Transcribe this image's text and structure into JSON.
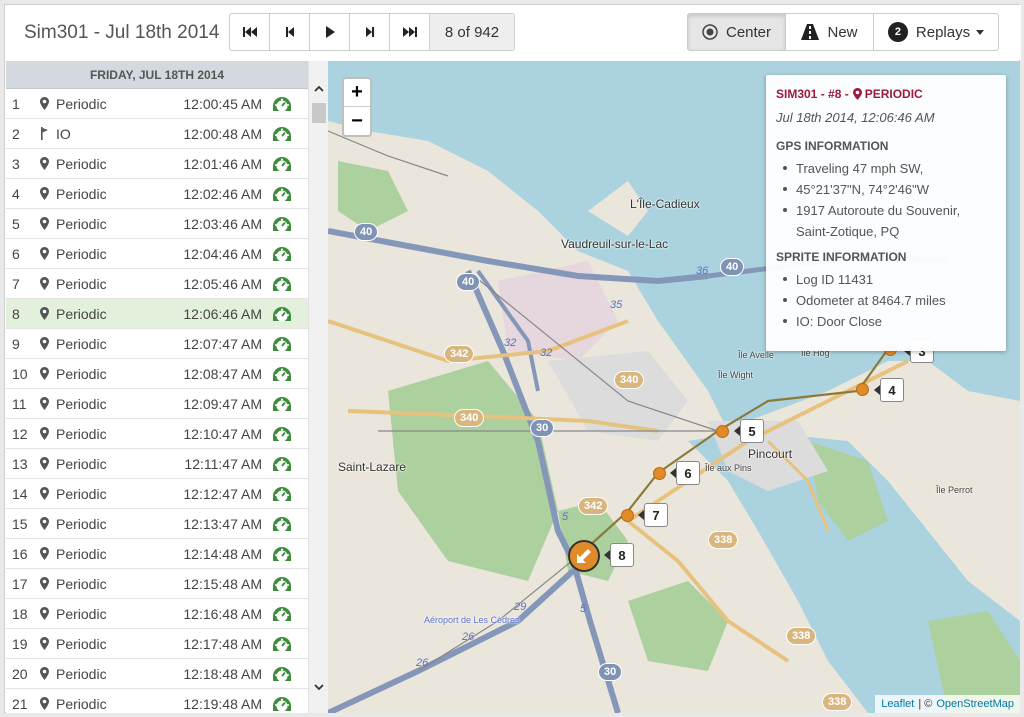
{
  "header": {
    "title": "Sim301 - Jul 18th 2014",
    "position_counter": "8 of 942",
    "center_label": "Center",
    "new_label": "New",
    "replays_label": "Replays",
    "replays_count": "2"
  },
  "list": {
    "day_header": "FRIDAY, JUL 18TH 2014",
    "selected_index": 8,
    "rows": [
      {
        "num": "1",
        "type": "Periodic",
        "icon": "pin-icon",
        "time": "12:00:45 AM"
      },
      {
        "num": "2",
        "type": "IO",
        "icon": "flag-icon",
        "time": "12:00:48 AM"
      },
      {
        "num": "3",
        "type": "Periodic",
        "icon": "pin-icon",
        "time": "12:01:46 AM"
      },
      {
        "num": "4",
        "type": "Periodic",
        "icon": "pin-icon",
        "time": "12:02:46 AM"
      },
      {
        "num": "5",
        "type": "Periodic",
        "icon": "pin-icon",
        "time": "12:03:46 AM"
      },
      {
        "num": "6",
        "type": "Periodic",
        "icon": "pin-icon",
        "time": "12:04:46 AM"
      },
      {
        "num": "7",
        "type": "Periodic",
        "icon": "pin-icon",
        "time": "12:05:46 AM"
      },
      {
        "num": "8",
        "type": "Periodic",
        "icon": "pin-icon",
        "time": "12:06:46 AM"
      },
      {
        "num": "9",
        "type": "Periodic",
        "icon": "pin-icon",
        "time": "12:07:47 AM"
      },
      {
        "num": "10",
        "type": "Periodic",
        "icon": "pin-icon",
        "time": "12:08:47 AM"
      },
      {
        "num": "11",
        "type": "Periodic",
        "icon": "pin-icon",
        "time": "12:09:47 AM"
      },
      {
        "num": "12",
        "type": "Periodic",
        "icon": "pin-icon",
        "time": "12:10:47 AM"
      },
      {
        "num": "13",
        "type": "Periodic",
        "icon": "pin-icon",
        "time": "12:11:47 AM"
      },
      {
        "num": "14",
        "type": "Periodic",
        "icon": "pin-icon",
        "time": "12:12:47 AM"
      },
      {
        "num": "15",
        "type": "Periodic",
        "icon": "pin-icon",
        "time": "12:13:47 AM"
      },
      {
        "num": "16",
        "type": "Periodic",
        "icon": "pin-icon",
        "time": "12:14:48 AM"
      },
      {
        "num": "17",
        "type": "Periodic",
        "icon": "pin-icon",
        "time": "12:15:48 AM"
      },
      {
        "num": "18",
        "type": "Periodic",
        "icon": "pin-icon",
        "time": "12:16:48 AM"
      },
      {
        "num": "19",
        "type": "Periodic",
        "icon": "pin-icon",
        "time": "12:17:48 AM"
      },
      {
        "num": "20",
        "type": "Periodic",
        "icon": "pin-icon",
        "time": "12:18:48 AM"
      },
      {
        "num": "21",
        "type": "Periodic",
        "icon": "pin-icon",
        "time": "12:19:48 AM"
      }
    ]
  },
  "popup": {
    "heading": "SIM301 - #8 -",
    "heading_type": "PERIODIC",
    "datetime": "Jul 18th 2014, 12:06:46 AM",
    "gps_title": "GPS INFORMATION",
    "gps": [
      "Traveling 47 mph SW,",
      "45°21'37\"N, 74°2'46\"W",
      "1917 Autoroute du Souvenir, Saint-Zotique, PQ"
    ],
    "sprite_title": "SPRITE INFORMATION",
    "sprite": [
      "Log ID 11431",
      "Odometer at 8464.7 miles",
      "IO: Door Close"
    ]
  },
  "map": {
    "zoom_in": "+",
    "zoom_out": "−",
    "places": {
      "ile_cadieux": "L'Île-Cadieux",
      "vaudreuil": "Vaudreuil-sur-le-Lac",
      "saint_lazare": "Saint-Lazare",
      "pincourt": "Pincourt",
      "ile_aux_pins": "Île aux Pins",
      "ile_perrot": "Île Perrot",
      "ile_avelle": "Île Avelle",
      "ile_hog": "Île Hog",
      "ile_wight": "Île Wight",
      "aeroport": "Aéroport de Les Cèdres"
    },
    "shields": {
      "r40a": "40",
      "r40b": "40",
      "r40c": "40",
      "r342a": "342",
      "r342b": "342",
      "r340a": "340",
      "r340b": "340",
      "r30a": "30",
      "r30b": "30",
      "r338a": "338",
      "r338b": "338",
      "r338c": "338"
    },
    "exits": {
      "e36": "36",
      "e35": "35",
      "e32": "32",
      "e32b": "32",
      "e5": "5",
      "e29": "29",
      "e26": "26",
      "e26b": "26",
      "e5b": "5"
    },
    "markers": [
      "3",
      "4",
      "5",
      "6",
      "7",
      "8"
    ],
    "attribution_leaflet": "Leaflet",
    "attribution_sep": "| ©",
    "attribution_osm": "OpenStreetMap"
  },
  "colors": {
    "selected_row": "#e3f1dc",
    "marker": "#e08a2a",
    "popup_title": "#9b1b3c",
    "water": "#aad3df",
    "forest": "#add19e",
    "highway": "#8497b8"
  }
}
